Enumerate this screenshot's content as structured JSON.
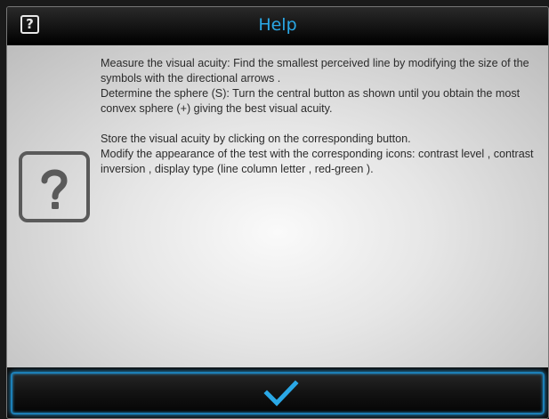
{
  "header": {
    "title": "Help",
    "icon": "question-mark-icon"
  },
  "content": {
    "icon": "question-mark-icon",
    "paragraphs": [
      "Measure the visual acuity: Find the smallest perceived line by modifying the size of the symbols with the directional arrows .",
      "Determine the sphere (S): Turn the central button as shown until you obtain the most convex sphere (+) giving the best visual acuity.",
      "",
      "Store the visual acuity by clicking on the corresponding button.",
      "Modify the appearance of the test with the corresponding icons: contrast level , contrast inversion , display type (line column letter , red-green )."
    ]
  },
  "footer": {
    "confirm_icon": "checkmark-icon"
  },
  "colors": {
    "title": "#2aa8e6",
    "accent": "#2a9bd8",
    "text": "#2b2b2b"
  }
}
